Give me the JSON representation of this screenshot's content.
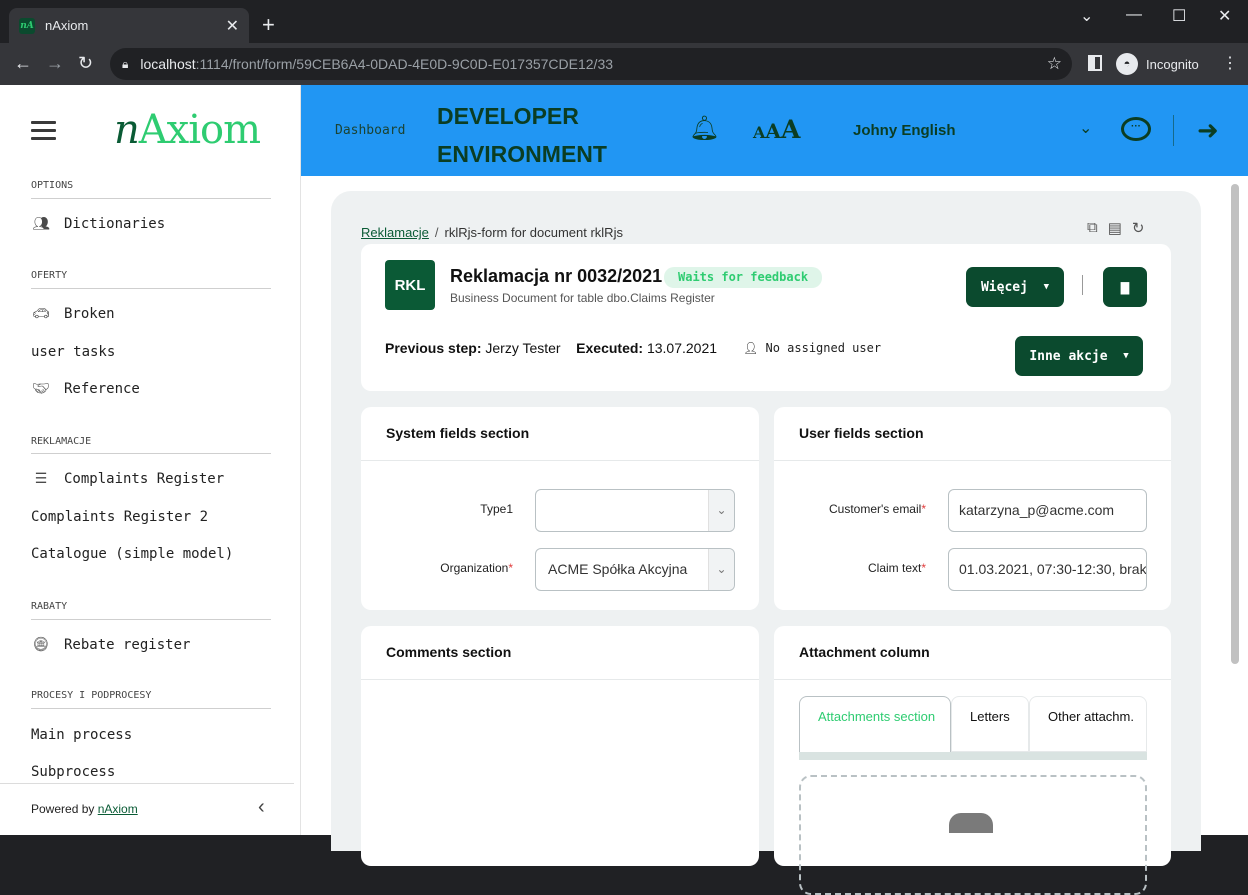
{
  "browser": {
    "tab_title": "nAxiom",
    "tab_favicon": "nA",
    "url_host": "localhost",
    "url_path": ":1114/front/form/59CEB6A4-0DAD-4E0D-9C0D-E017357CDE12/33",
    "profile_label": "Incognito"
  },
  "sidebar": {
    "logo": {
      "n": "n",
      "rest": "Axiom"
    },
    "sections": [
      {
        "title": "OPTIONS",
        "items": [
          {
            "label": "Dictionaries",
            "icon": "users-icon"
          }
        ]
      },
      {
        "title": "OFERTY",
        "items": [
          {
            "label": "Broken",
            "icon": "car-crash-icon"
          },
          {
            "label": "user tasks",
            "icon": ""
          },
          {
            "label": "Reference",
            "icon": "handshake-icon"
          }
        ]
      },
      {
        "title": "REKLAMACJE",
        "items": [
          {
            "label": "Complaints Register",
            "icon": "list-icon"
          },
          {
            "label": "Complaints Register 2",
            "icon": ""
          },
          {
            "label": "Catalogue (simple model)",
            "icon": ""
          }
        ]
      },
      {
        "title": "RABATY",
        "items": [
          {
            "label": "Rebate register",
            "icon": "coins-icon"
          }
        ]
      },
      {
        "title": "PROCESY I PODPROCESY",
        "items": [
          {
            "label": "Main process",
            "icon": ""
          },
          {
            "label": "Subprocess",
            "icon": ""
          }
        ]
      }
    ],
    "footer": {
      "powered_by": "Powered by ",
      "brand": "nAxiom"
    }
  },
  "header": {
    "dashboard": "Dashboard",
    "environment": "DEVELOPER ENVIRONMENT",
    "font_sizes": [
      "A",
      "A",
      "A"
    ],
    "user": "Johny English"
  },
  "breadcrumb": {
    "root": "Reklamacje",
    "separator": "/",
    "current": "rklRjs-form for document rklRjs"
  },
  "document": {
    "badge": "RKL",
    "title": "Reklamacja nr 0032/2021",
    "status": "Waits for feedback",
    "subtitle": "Business Document for table dbo.Claims Register",
    "more_button": "Więcej",
    "other_actions_button": "Inne akcje",
    "prev_step_label": "Previous step:",
    "prev_step_value": " Jerzy Tester",
    "executed_label": "Executed:",
    "executed_value": " 13.07.2021",
    "assigned": "No assigned user"
  },
  "system_section": {
    "title": "System fields section",
    "type_label": "Type1",
    "type_value": "",
    "org_label": "Organization",
    "org_value": "ACME Spółka Akcyjna"
  },
  "user_section": {
    "title": "User fields section",
    "email_label": "Customer's email",
    "email_value": "katarzyna_p@acme.com",
    "claim_label": "Claim text",
    "claim_value": "01.03.2021, 07:30-12:30, brak"
  },
  "comments_section": {
    "title": "Comments section"
  },
  "attachments": {
    "title": "Attachment column",
    "tabs": [
      "Attachments section",
      "Letters",
      "Other attachm."
    ]
  },
  "colors": {
    "brand_dark": "#0b4a2e",
    "brand_green": "#2ecc71",
    "header_blue": "#2196f3"
  }
}
